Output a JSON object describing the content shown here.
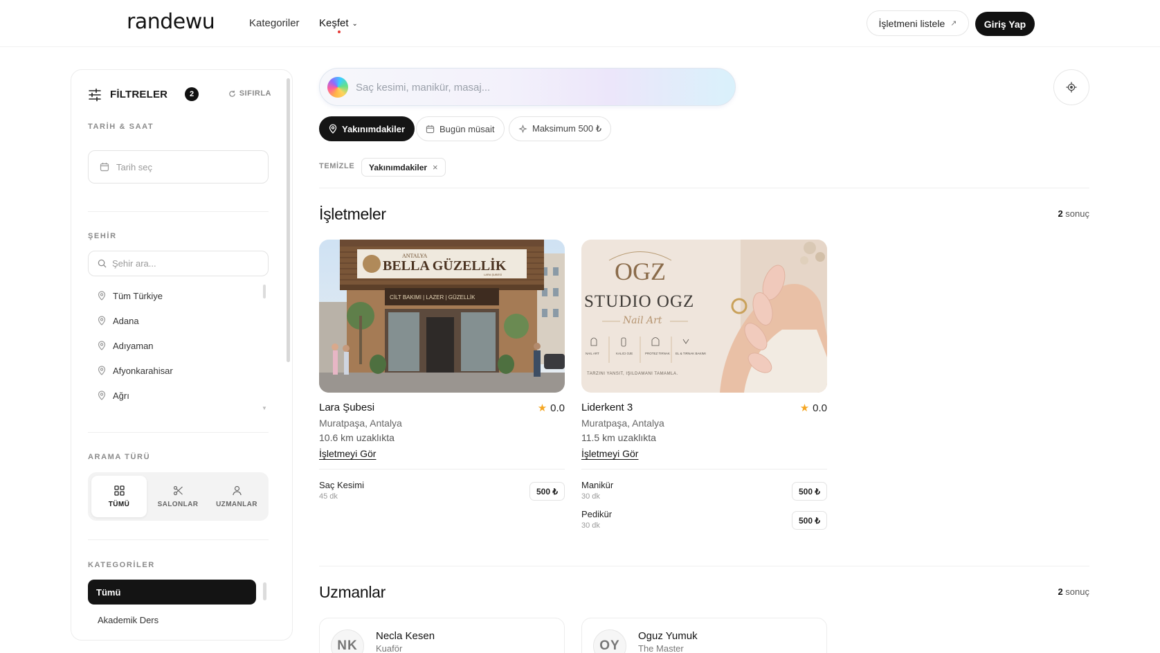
{
  "header": {
    "logo": "randewu",
    "nav": {
      "categories": "Kategoriler",
      "explore": "Keşfet"
    },
    "list_business": "İşletmeni listele",
    "login": "Giriş Yap"
  },
  "sidebar": {
    "title": "FİLTRELER",
    "badge": "2",
    "reset": "SIFIRLA",
    "date_section": "TARİH & SAAT",
    "date_placeholder": "Tarih seç",
    "city_section": "ŞEHİR",
    "city_search_placeholder": "Şehir ara...",
    "cities": [
      "Tüm Türkiye",
      "Adana",
      "Adıyaman",
      "Afyonkarahisar",
      "Ağrı"
    ],
    "search_type_section": "ARAMA TÜRÜ",
    "search_types": [
      "TÜMÜ",
      "SALONLAR",
      "UZMANLAR"
    ],
    "categories_section": "KATEGORİLER",
    "categories": [
      "Tümü",
      "Akademik Ders"
    ]
  },
  "search": {
    "placeholder": "Saç kesimi, manikür, masaj..."
  },
  "chips": [
    "Yakınımdakiler",
    "Bugün müsait",
    "Maksimum 500 ₺"
  ],
  "active_filters": {
    "clear_label": "TEMİZLE",
    "tags": [
      "Yakınımdakiler"
    ]
  },
  "businesses": {
    "title": "İşletmeler",
    "count": "2",
    "count_suffix": "sonuç",
    "items": [
      {
        "name": "Lara Şubesi",
        "rating": "0.0",
        "location": "Muratpaşa, Antalya",
        "distance": "10.6 km uzaklıkta",
        "link": "İşletmeyi Gör",
        "image_sign_top": "ANTALYA",
        "image_sign_main": "BELLA GÜZELLİK",
        "image_sign_sub": "LARA ŞUBESİ",
        "image_sign_services": "CİLT BAKIMI | LAZER | GÜZELLİK",
        "services": [
          {
            "name": "Saç Kesimi",
            "duration": "45 dk",
            "price": "500 ₺"
          }
        ]
      },
      {
        "name": "Liderkent 3",
        "rating": "0.0",
        "location": "Muratpaşa, Antalya",
        "distance": "11.5 km uzaklıkta",
        "link": "İşletmeyi Gör",
        "image_logo": "OGZ",
        "image_title": "STUDIO OGZ",
        "image_script": "Nail Art",
        "image_services": [
          "NAIL ART",
          "KALICI OJE",
          "PROTEZ TIRNAK",
          "EL & TIRNAK BAKIMI"
        ],
        "image_slogan": "TARZINI YANSIT, IŞILDAMANI TAMAMLA.",
        "services": [
          {
            "name": "Manikür",
            "duration": "30 dk",
            "price": "500 ₺"
          },
          {
            "name": "Pedikür",
            "duration": "30 dk",
            "price": "500 ₺"
          }
        ]
      }
    ]
  },
  "experts": {
    "title": "Uzmanlar",
    "count": "2",
    "count_suffix": "sonuç",
    "items": [
      {
        "initials": "NK",
        "name": "Necla Kesen",
        "role": "Kuaför"
      },
      {
        "initials": "OY",
        "name": "Oguz Yumuk",
        "role": "The Master"
      }
    ]
  },
  "colors": {
    "primary": "#111111",
    "accent_red": "#e53935",
    "star": "#f5a623"
  }
}
